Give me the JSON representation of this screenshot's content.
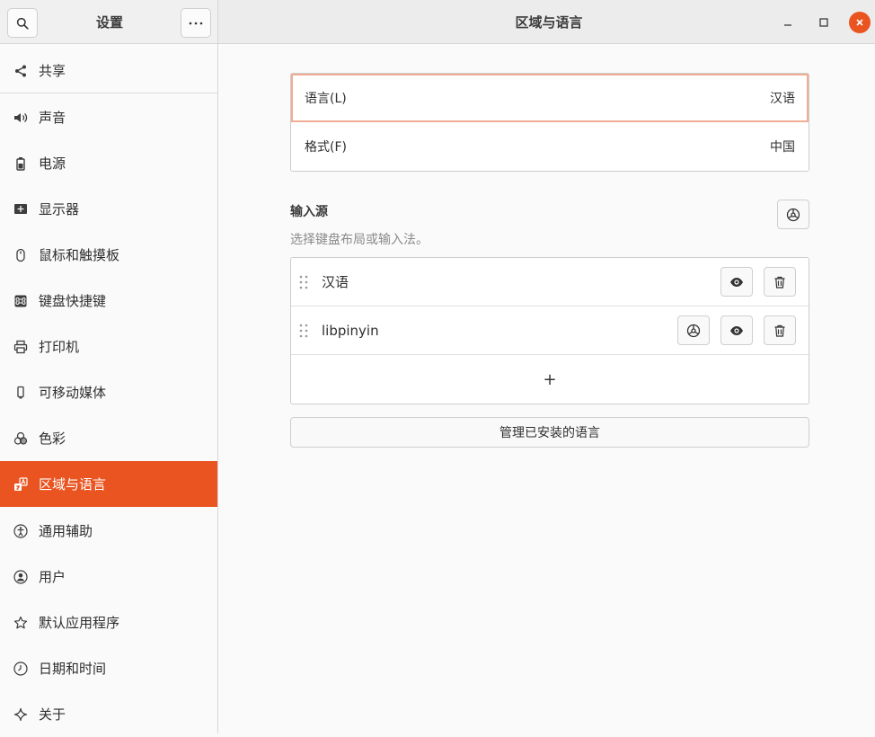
{
  "window": {
    "sidebar_title": "设置",
    "page_title": "区域与语言"
  },
  "colors": {
    "accent": "#e95420",
    "focus_outline": "#f1ad94"
  },
  "sidebar": {
    "items": [
      {
        "label": "共享",
        "icon": "share-icon"
      },
      {
        "label": "声音",
        "icon": "speaker-icon"
      },
      {
        "label": "电源",
        "icon": "battery-icon"
      },
      {
        "label": "显示器",
        "icon": "display-icon"
      },
      {
        "label": "鼠标和触摸板",
        "icon": "mouse-icon"
      },
      {
        "label": "键盘快捷键",
        "icon": "keyboard-shortcut-icon"
      },
      {
        "label": "打印机",
        "icon": "printer-icon"
      },
      {
        "label": "可移动媒体",
        "icon": "removable-media-icon"
      },
      {
        "label": "色彩",
        "icon": "color-icon"
      },
      {
        "label": "区域与语言",
        "icon": "region-language-icon",
        "active": true
      },
      {
        "label": "通用辅助",
        "icon": "accessibility-icon"
      },
      {
        "label": "用户",
        "icon": "user-icon"
      },
      {
        "label": "默认应用程序",
        "icon": "star-icon"
      },
      {
        "label": "日期和时间",
        "icon": "clock-icon"
      },
      {
        "label": "关于",
        "icon": "sparkle-icon"
      }
    ]
  },
  "main": {
    "language": {
      "label": "语言(L)",
      "value": "汉语"
    },
    "formats": {
      "label": "格式(F)",
      "value": "中国"
    },
    "input_sources": {
      "title": "输入源",
      "subtitle": "选择键盘布局或输入法。",
      "items": [
        {
          "label": "汉语",
          "has_settings": false
        },
        {
          "label": "libpinyin",
          "has_settings": true
        }
      ],
      "add_label": "+"
    },
    "manage_languages_label": "管理已安装的语言"
  }
}
